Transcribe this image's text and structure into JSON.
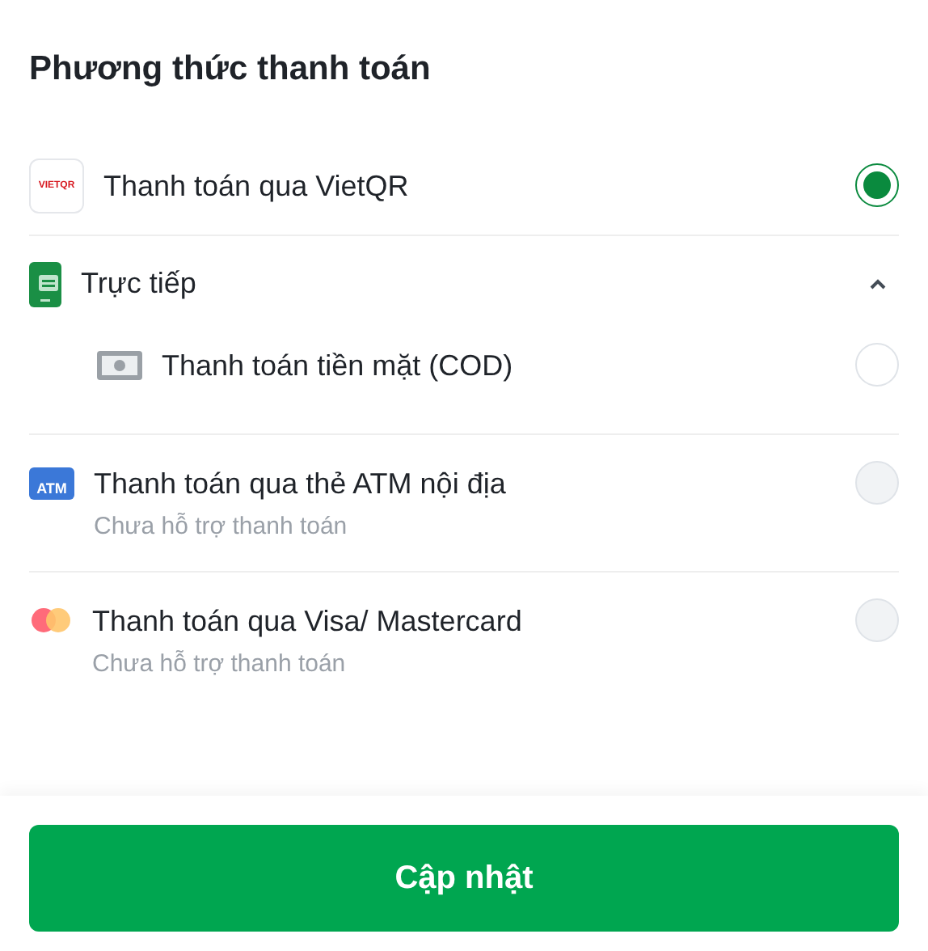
{
  "title": "Phương thức thanh toán",
  "methods": [
    {
      "kind": "vietqr",
      "icon_text": "VIETQR",
      "label": "Thanh toán qua VietQR",
      "selected": true,
      "disabled": false
    },
    {
      "kind": "group",
      "label": "Trực tiếp",
      "expanded": true,
      "children": [
        {
          "kind": "cash",
          "label": "Thanh toán tiền mặt (COD)",
          "selected": false,
          "disabled": false
        }
      ]
    },
    {
      "kind": "atm",
      "icon_text": "ATM",
      "label": "Thanh toán qua thẻ ATM nội địa",
      "note": "Chưa hỗ trợ thanh toán",
      "selected": false,
      "disabled": true
    },
    {
      "kind": "card",
      "label": "Thanh toán qua Visa/ Mastercard",
      "note": "Chưa hỗ trợ thanh toán",
      "selected": false,
      "disabled": true
    }
  ],
  "button": "Cập nhật"
}
